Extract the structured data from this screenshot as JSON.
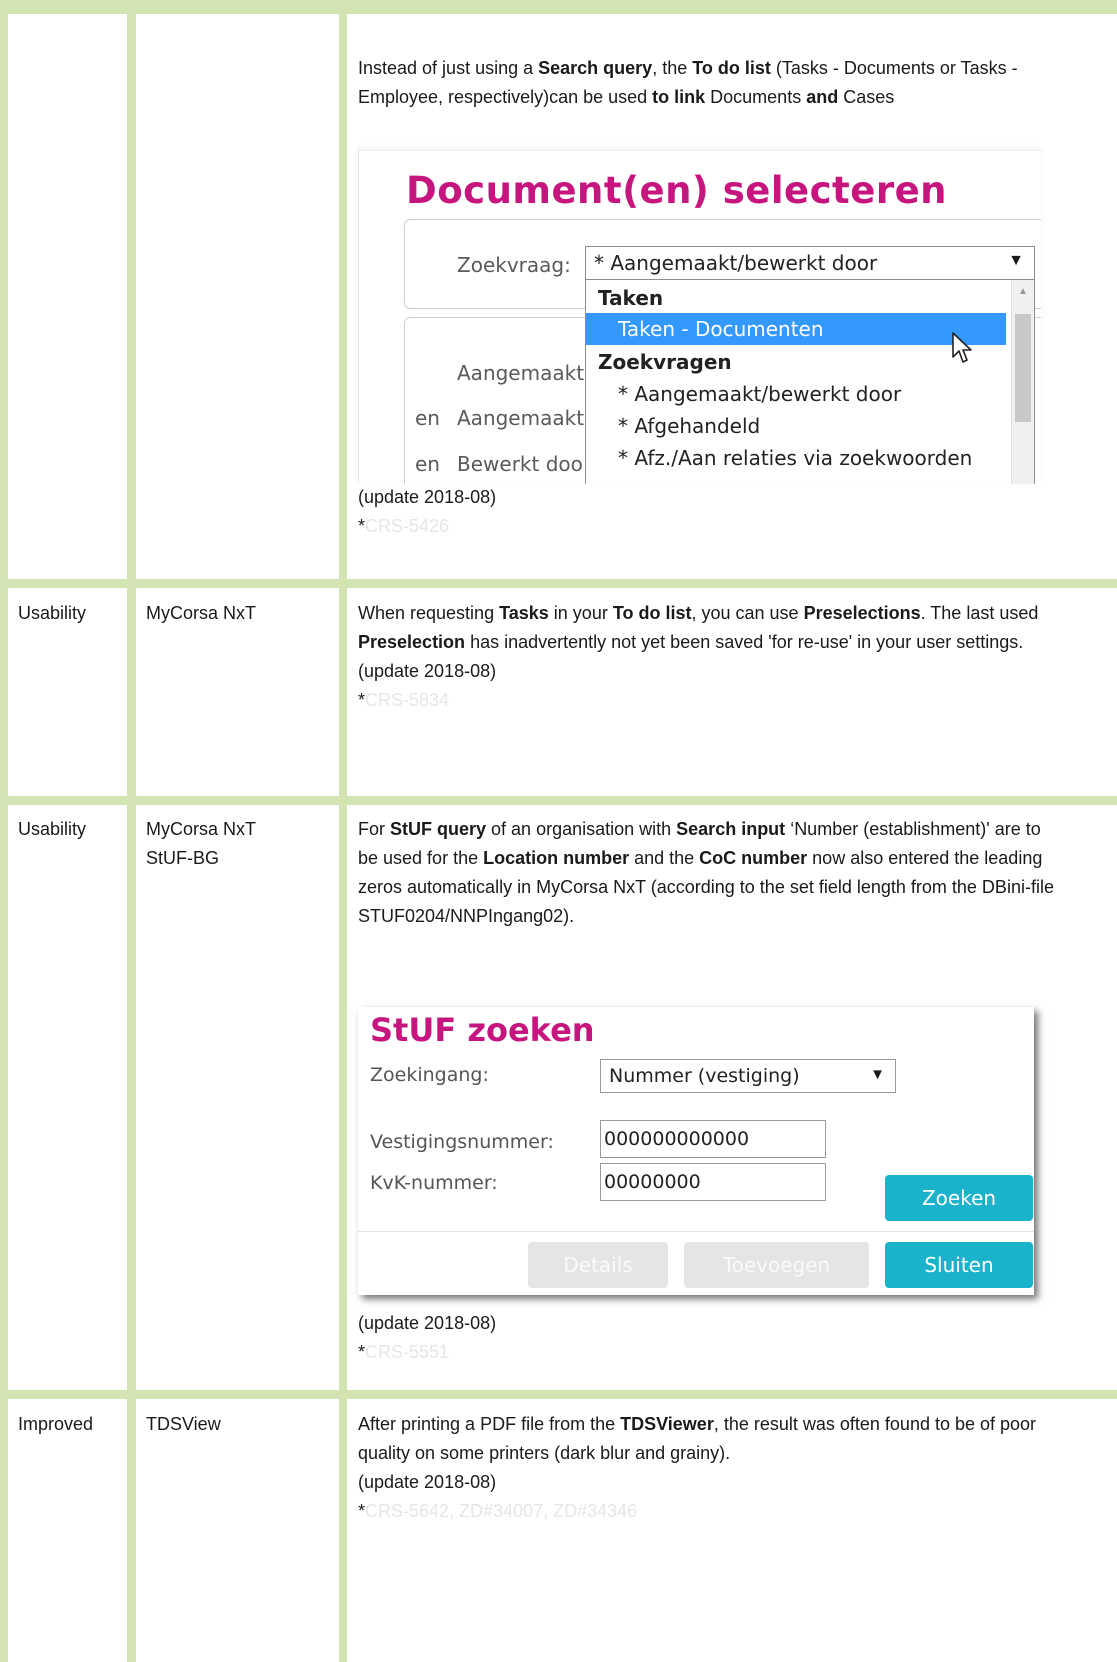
{
  "row0": {
    "desc_parts": [
      {
        "t": "Instead of just using a ",
        "b": false
      },
      {
        "t": "Search query",
        "b": true
      },
      {
        "t": ", the ",
        "b": false
      },
      {
        "t": "To do list",
        "b": true
      },
      {
        "t": " (Tasks - Documents or Tasks - Employee, respectively)can be used ",
        "b": false
      },
      {
        "t": "to link",
        "b": true
      },
      {
        "t": " Documents ",
        "b": false
      },
      {
        "t": "and",
        "b": true
      },
      {
        "t": " Cases",
        "b": false
      }
    ],
    "update": "(update 2018-08)",
    "ref_star": "*",
    "ref": "CRS-5426"
  },
  "doc_select_screenshot": {
    "title": "Document(en) selecteren",
    "query_label": "Zoekvraag:",
    "query_value": "* Aangemaakt/bewerkt door",
    "dropdown": {
      "group1": "Taken",
      "selected": "Taken - Documenten",
      "group2": "Zoekvragen",
      "items": [
        "* Aangemaakt/bewerkt door",
        "* Afgehandeld",
        "* Afz./Aan relaties via zoekwoorden"
      ]
    },
    "rows": [
      {
        "prefix": "",
        "label": "Aangemaakt"
      },
      {
        "prefix": "en",
        "label": "Aangemaakt"
      },
      {
        "prefix": "en",
        "label": "Bewerkt doo"
      }
    ]
  },
  "row1": {
    "type": "Usability",
    "product": "MyCorsa NxT",
    "desc_parts": [
      {
        "t": "When requesting ",
        "b": false
      },
      {
        "t": "Tasks",
        "b": true
      },
      {
        "t": " in your ",
        "b": false
      },
      {
        "t": "To do list",
        "b": true
      },
      {
        "t": ", you can use ",
        "b": false
      },
      {
        "t": "Preselections",
        "b": true
      },
      {
        "t": ". The last used ",
        "b": false
      },
      {
        "t": "Preselection",
        "b": true
      },
      {
        "t": " has inadvertently not yet been saved 'for re-use' in your user settings.",
        "b": false
      }
    ],
    "update": "(update 2018-08)",
    "ref_star": "*",
    "ref": "CRS-5834"
  },
  "row2": {
    "type": "Usability",
    "product_line1": "MyCorsa NxT",
    "product_line2": "StUF-BG",
    "desc_parts": [
      {
        "t": "For ",
        "b": false
      },
      {
        "t": "StUF query",
        "b": true
      },
      {
        "t": " of an organisation with ",
        "b": false
      },
      {
        "t": "Search input",
        "b": true
      },
      {
        "t": " ‘Number (establishment)' are to be used for the ",
        "b": false
      },
      {
        "t": "Location number",
        "b": true
      },
      {
        "t": " and the ",
        "b": false
      },
      {
        "t": "CoC number",
        "b": true
      },
      {
        "t": " now also entered the leading zeros automatically in MyCorsa NxT (according to the set field length from the DBini-file STUF0204/NNPIngang02).",
        "b": false
      }
    ],
    "update": "(update 2018-08)",
    "ref_star": "*",
    "ref": "CRS-5551"
  },
  "stuf_screenshot": {
    "title": "StUF zoeken",
    "zoekingang_label": "Zoekingang:",
    "zoekingang_value": "Nummer (vestiging)",
    "vestiging_label": "Vestigingsnummer:",
    "vestiging_value": "000000000000",
    "kvk_label": "KvK-nummer:",
    "kvk_value": "00000000",
    "btn_zoeken": "Zoeken",
    "btn_details": "Details",
    "btn_toevoegen": "Toevoegen",
    "btn_sluiten": "Sluiten"
  },
  "row3": {
    "type": "Improved",
    "product": "TDSView",
    "desc_parts": [
      {
        "t": "After printing a PDF file from the ",
        "b": false
      },
      {
        "t": "TDSViewer",
        "b": true
      },
      {
        "t": ", the result was often found to be of poor quality on some printers (dark blur and grainy).",
        "b": false
      }
    ],
    "update": "(update 2018-08)",
    "ref_star": "*",
    "ref": "CRS-5642, ZD#34007, ZD#34346"
  },
  "colors": {
    "grid": "#d3e4b3",
    "magenta_title": "#c7157f",
    "button_teal": "#1bb3cc",
    "dropdown_highlight": "#3399ff",
    "ref_text": "#e6e6e6"
  }
}
